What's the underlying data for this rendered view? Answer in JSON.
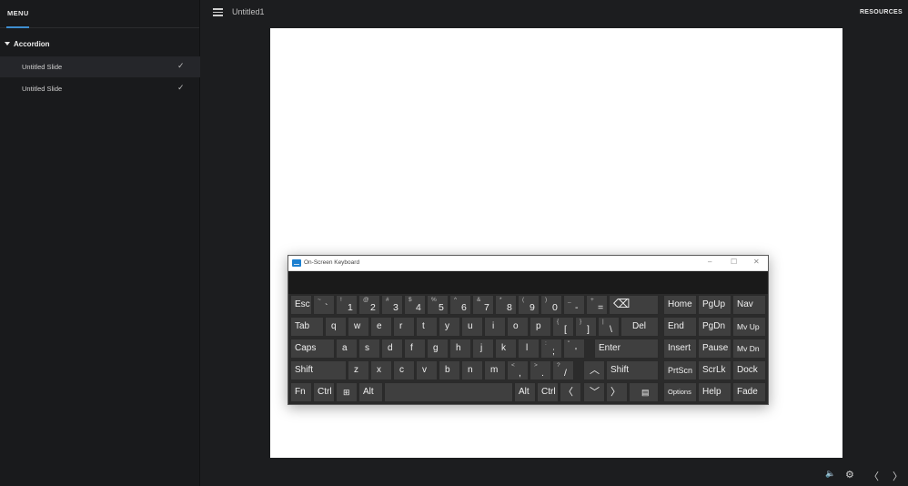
{
  "sidebar": {
    "menu_label": "MENU",
    "accordion_label": "Accordion",
    "items": [
      {
        "label": "Untitled Slide",
        "check": "✓"
      },
      {
        "label": "Untitled Slide",
        "check": "✓"
      }
    ]
  },
  "topbar": {
    "title": "Untitled1",
    "resources_label": "RESOURCES"
  },
  "osk": {
    "title": "On-Screen Keyboard",
    "controls": {
      "min": "–",
      "max": "☐",
      "close": "✕"
    },
    "keys": {
      "esc": "Esc",
      "backtick_shift": "~",
      "backtick": "`",
      "k1_s": "!",
      "k1": "1",
      "k2_s": "@",
      "k2": "2",
      "k3_s": "#",
      "k3": "3",
      "k4_s": "$",
      "k4": "4",
      "k5_s": "%",
      "k5": "5",
      "k6_s": "^",
      "k6": "6",
      "k7_s": "&",
      "k7": "7",
      "k8_s": "*",
      "k8": "8",
      "k9_s": "(",
      "k9": "9",
      "k0_s": ")",
      "k0": "0",
      "minus_s": "_",
      "minus": "-",
      "eq_s": "+",
      "eq": "=",
      "bksp": "⌫",
      "home": "Home",
      "pgup": "PgUp",
      "nav": "Nav",
      "tab": "Tab",
      "q": "q",
      "w": "w",
      "e": "e",
      "r": "r",
      "t": "t",
      "y": "y",
      "u": "u",
      "i": "i",
      "o": "o",
      "p": "p",
      "lbr_s": "{",
      "lbr": "[",
      "rbr_s": "}",
      "rbr": "]",
      "bsl_s": "|",
      "bsl": "\\",
      "del": "Del",
      "end": "End",
      "pgdn": "PgDn",
      "mvup": "Mv Up",
      "caps": "Caps",
      "a": "a",
      "s": "s",
      "d": "d",
      "f": "f",
      "g": "g",
      "h": "h",
      "j": "j",
      "k": "k",
      "l": "l",
      "semi_s": ":",
      "semi": ";",
      "quot_s": "\"",
      "quot": "'",
      "enter": "Enter",
      "insert": "Insert",
      "pause": "Pause",
      "mvdn": "Mv Dn",
      "shift": "Shift",
      "z": "z",
      "x": "x",
      "c": "c",
      "v": "v",
      "b": "b",
      "n": "n",
      "m": "m",
      "comma_s": "<",
      "comma": ",",
      "dot_s": ">",
      "dot": ".",
      "slash_s": "?",
      "slash": "/",
      "up": "︿",
      "shift_r": "Shift",
      "prtscn": "PrtScn",
      "scrlk": "ScrLk",
      "dock": "Dock",
      "fn": "Fn",
      "ctrl": "Ctrl",
      "win": "⊞",
      "alt": "Alt",
      "alt_r": "Alt",
      "ctrl_r": "Ctrl",
      "left": "〈",
      "down": "﹀",
      "right": "〉",
      "menu": "▤",
      "options": "Options",
      "help": "Help",
      "fade": "Fade"
    }
  },
  "bottombar": {
    "volume_icon": "🔈",
    "settings_icon": "⚙",
    "prev_icon": "〈",
    "next_icon": "〉"
  }
}
